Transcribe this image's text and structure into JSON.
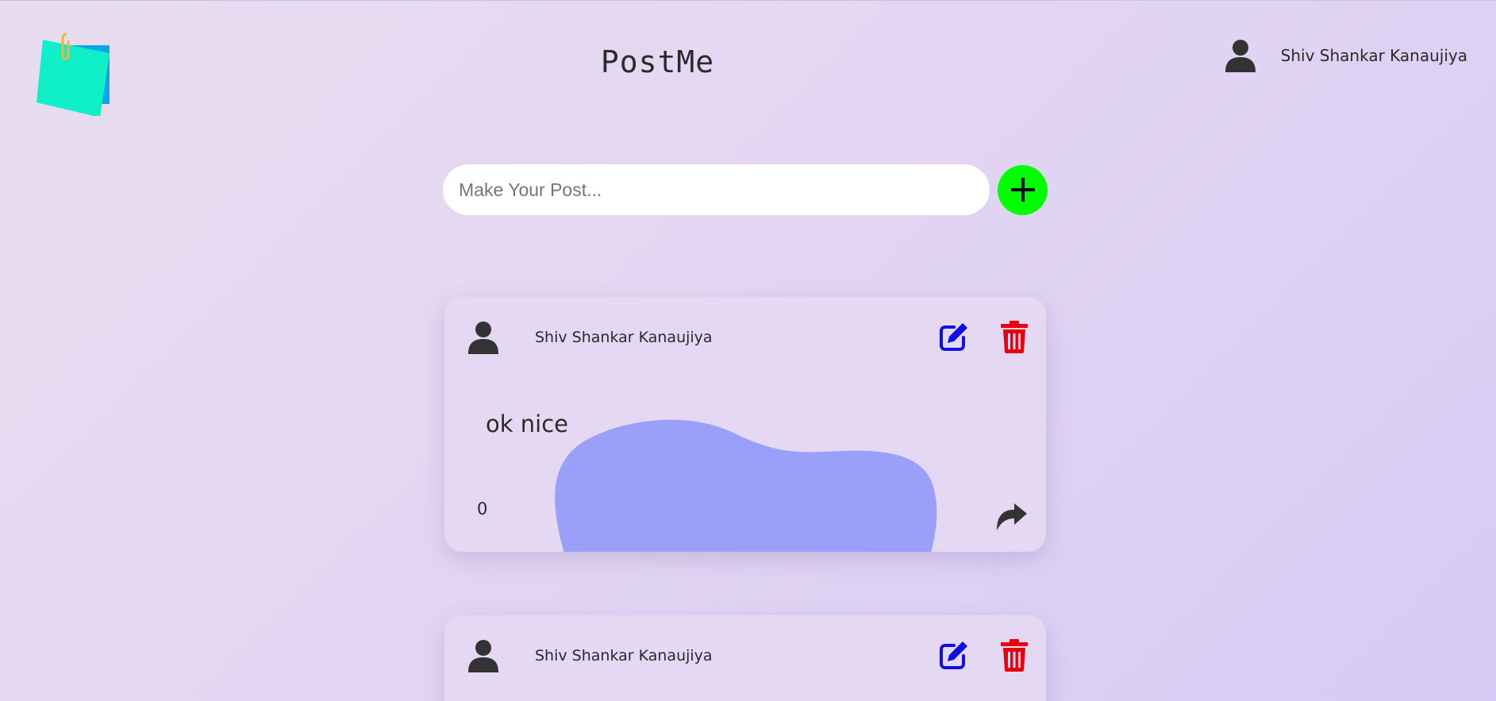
{
  "app": {
    "title": "PostMe"
  },
  "header": {
    "user_name": "Shiv Shankar Kanaujiya"
  },
  "composer": {
    "placeholder": "Make Your Post..."
  },
  "colors": {
    "accent_add": "#00ff00",
    "edit": "#1010e6",
    "delete": "#e8000b",
    "blob": "#9aa0f7"
  },
  "posts": [
    {
      "author": "Shiv Shankar Kanaujiya",
      "text": "ok nice",
      "likes": "0"
    },
    {
      "author": "Shiv Shankar Kanaujiya"
    }
  ],
  "icons": [
    "note-logo-icon",
    "user-icon",
    "plus-icon",
    "edit-icon",
    "trash-icon",
    "share-icon"
  ]
}
